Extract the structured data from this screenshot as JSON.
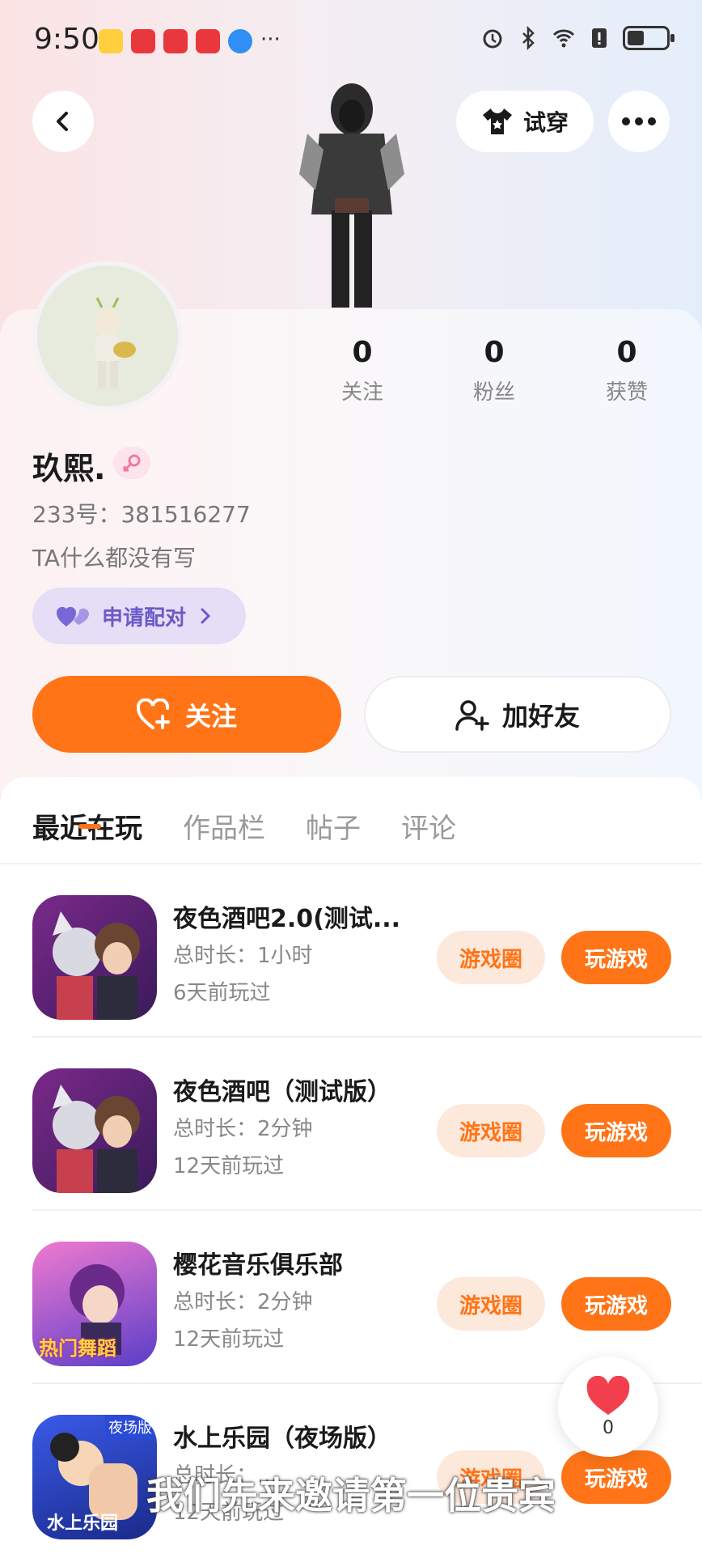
{
  "status_bar": {
    "time": "9:50",
    "more_indicator": "···"
  },
  "header": {
    "tryon_label": "试穿"
  },
  "profile": {
    "stats": [
      {
        "value": "0",
        "label": "关注"
      },
      {
        "value": "0",
        "label": "粉丝"
      },
      {
        "value": "0",
        "label": "获赞"
      }
    ],
    "nickname": "玖熙.",
    "user_id": "233号：381516277",
    "bio": "TA什么都没有写",
    "pair_label": "申请配对",
    "follow_label": "关注",
    "add_friend_label": "加好友"
  },
  "tabs": [
    {
      "label": "最近在玩",
      "active": true
    },
    {
      "label": "作品栏",
      "active": false
    },
    {
      "label": "帖子",
      "active": false
    },
    {
      "label": "评论",
      "active": false
    }
  ],
  "games": [
    {
      "name": "夜色酒吧2.0(测试...",
      "duration": "总时长：1小时",
      "last_played": "6天前玩过",
      "circle_label": "游戏圈",
      "play_label": "玩游戏"
    },
    {
      "name": "夜色酒吧（测试版）",
      "duration": "总时长：2分钟",
      "last_played": "12天前玩过",
      "circle_label": "游戏圈",
      "play_label": "玩游戏"
    },
    {
      "name": "樱花音乐俱乐部",
      "duration": "总时长：2分钟",
      "last_played": "12天前玩过",
      "circle_label": "游戏圈",
      "play_label": "玩游戏",
      "icon_text": "热门舞蹈"
    },
    {
      "name": "水上乐园（夜场版）",
      "duration": "总时长：...",
      "last_played": "12天前玩过",
      "circle_label": "游戏圈",
      "play_label": "玩游戏",
      "icon_text": "水上乐园",
      "icon_badge": "夜场版"
    }
  ],
  "like_widget": {
    "count": "0"
  },
  "overlay_subtitle": "我们先来邀请第一位贵宾",
  "colors": {
    "accent": "#ff7417",
    "accent_soft": "#fde8dc",
    "pair_purple": "#6c5ac8"
  }
}
